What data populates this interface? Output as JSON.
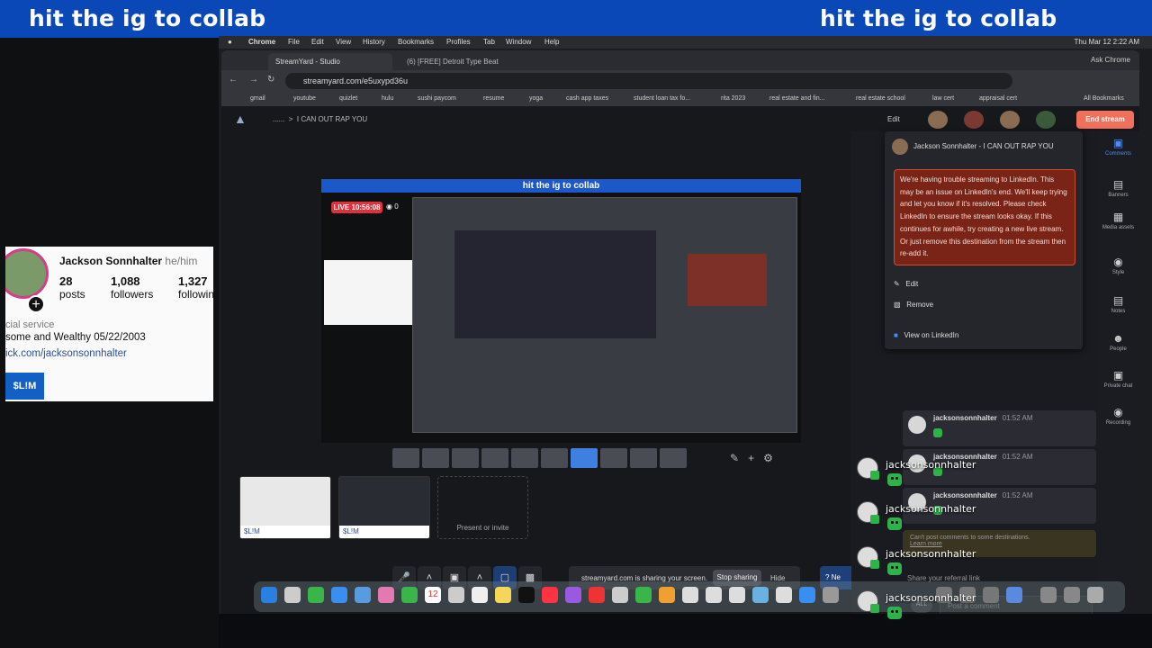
{
  "overlay": {
    "banner_left": "hit the ig to collab",
    "banner_right": "hit the ig to collab"
  },
  "profile": {
    "name": "Jackson Sonnhalter",
    "pronouns": "he/him",
    "posts_count": "28",
    "posts_label": "posts",
    "followers_count": "1,088",
    "followers_label": "followers",
    "following_count": "1,327",
    "following_label": "followin",
    "category": "cial service",
    "bio": "some and Wealthy 05/22/2003",
    "link": "ick.com/jacksonsonnhalter",
    "badge": "$L!M"
  },
  "menubar": {
    "app": "Chrome",
    "items": [
      "File",
      "Edit",
      "View",
      "History",
      "Bookmarks",
      "Profiles",
      "Tab",
      "Window",
      "Help"
    ],
    "clock": "Thu Mar 12  2:22 AM"
  },
  "browser": {
    "tabs": [
      {
        "label": "StreamYard - Studio",
        "active": true
      },
      {
        "label": "(6) [FREE] Detroit Type Beat",
        "active": false
      }
    ],
    "ask": "Ask Chrome",
    "url": "streamyard.com/e5uxypd36u",
    "bookmarks": [
      "gmail",
      "youtube",
      "quizlet",
      "hulu",
      "sushi paycom",
      "resume",
      "yoga",
      "cash app taxes",
      "student loan tax fo...",
      "rita 2023",
      "real estate and fin...",
      "real estate school",
      "law cert",
      "appraisal cert",
      "All Bookmarks"
    ]
  },
  "studio": {
    "breadcrumb_dots": "......",
    "breadcrumb_sep": ">",
    "broadcast_title": "I CAN OUT RAP YOU",
    "edit_label": "Edit",
    "end_stream": "End stream",
    "stage_banner": "hit the ig to collab",
    "live_timer": "LIVE 10:56:08",
    "viewer_count": "0",
    "thumbs": [
      {
        "label": "$L!M"
      },
      {
        "label": "$L!M"
      }
    ],
    "present_label": "Present or invite",
    "share_message": "streamyard.com is sharing your screen.",
    "stop_sharing": "Stop sharing",
    "hide": "Hide",
    "help_label": "Ne"
  },
  "sidebar": {
    "items": [
      {
        "label": "Comments"
      },
      {
        "label": "Banners"
      },
      {
        "label": "Media assets"
      },
      {
        "label": "Style"
      },
      {
        "label": "Notes"
      },
      {
        "label": "People"
      },
      {
        "label": "Private chat"
      },
      {
        "label": "Recording"
      }
    ]
  },
  "destination_menu": {
    "title": "Jackson Sonnhalter - I CAN OUT RAP YOU",
    "warning": "We're having trouble streaming to LinkedIn. This may be an issue on LinkedIn's end. We'll keep trying and let you know if it's resolved. Please check LinkedIn to ensure the stream looks okay. If this continues for awhile, try creating a new live stream. Or just remove this destination from the stream then re-add it.",
    "edit": "Edit",
    "remove": "Remove",
    "view": "View on LinkedIn"
  },
  "comments": {
    "items": [
      {
        "user": "jacksonsonnhalter",
        "time": "01:52 AM"
      },
      {
        "user": "jacksonsonnhalter",
        "time": "01:52 AM"
      },
      {
        "user": "jacksonsonnhalter",
        "time": "01:52 AM"
      }
    ],
    "cant_post": "Can't post comments to some destinations.",
    "learn_more": "Learn more",
    "referral": "Share your referral link",
    "all": "ALL",
    "post_placeholder": "Post a comment"
  },
  "chat_overlay": {
    "items": [
      {
        "user": "jacksonsonnhalter"
      },
      {
        "user": "jacksonsonnhalter"
      },
      {
        "user": "jacksonsonnhalter"
      },
      {
        "user": "jacksonsonnhalter"
      }
    ]
  },
  "dock": {
    "calendar_day": "12"
  },
  "colors": {
    "banner": "#0a48b8",
    "end_stream": "#f0705c",
    "warning": "#7a2418",
    "accent": "#4a8cf5",
    "live": "#e0303a"
  }
}
